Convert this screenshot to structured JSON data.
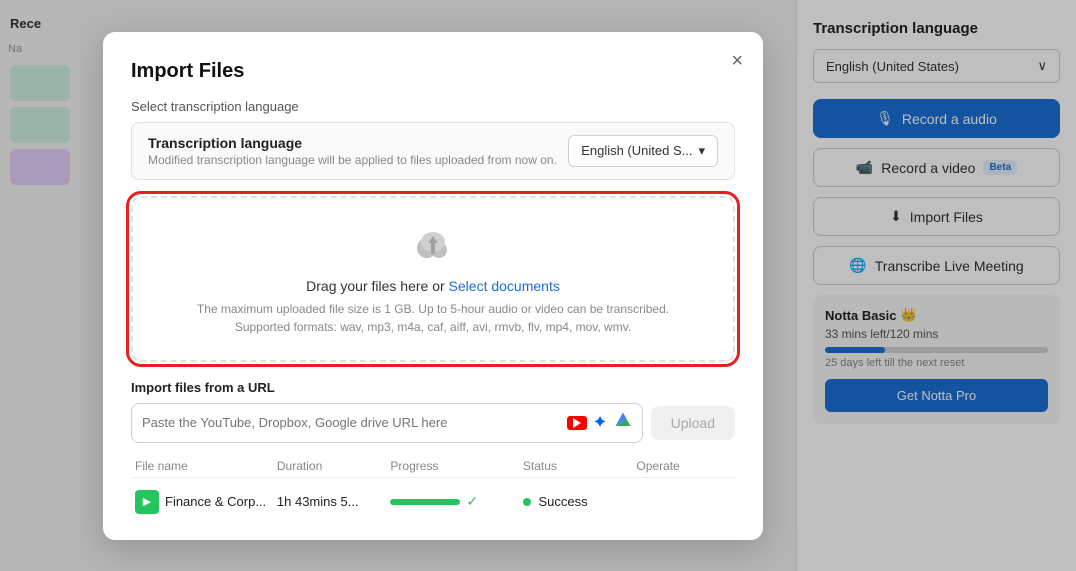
{
  "modal": {
    "title": "Import Files",
    "close_label": "×",
    "select_lang_label": "Select transcription language",
    "lang_bar": {
      "title": "Transcription language",
      "subtitle": "Modified transcription language will be applied to files uploaded from now on.",
      "selected": "English (United S...",
      "chevron": "▾"
    },
    "drop_zone": {
      "icon": "⬆",
      "text": "Drag your files here or ",
      "link_text": "Select documents",
      "sub_line1": "The maximum uploaded file size is 1 GB. Up to 5-hour audio or video can be transcribed.",
      "sub_line2": "Supported formats: wav, mp3, m4a, caf, aiff, avi, rmvb, flv, mp4, mov, wmv."
    },
    "url_section": {
      "label": "Import files from a URL",
      "placeholder": "Paste the YouTube, Dropbox, Google drive URL here",
      "upload_btn": "Upload"
    },
    "file_table": {
      "headers": [
        "File name",
        "Duration",
        "Progress",
        "Status",
        "Operate"
      ],
      "rows": [
        {
          "name": "Finance & Corp...",
          "duration": "1h 43mins 5...",
          "status": "Success"
        }
      ]
    }
  },
  "sidebar": {
    "transcription_language_title": "Transcription language",
    "language_selected": "English (United States)",
    "chevron": "∨",
    "buttons": {
      "record_audio": "Record a audio",
      "record_video": "Record a video",
      "beta_label": "Beta",
      "import_files": "Import Files",
      "transcribe_live": "Transcribe Live Meeting"
    },
    "notta_basic": {
      "title": "Notta Basic",
      "mins_left": "33 mins left/120 mins",
      "reset_text": "25 days left till the next reset",
      "get_pro": "Get Notta Pro",
      "progress_percent": 27
    }
  },
  "left_panel": {
    "title": "Rece"
  }
}
